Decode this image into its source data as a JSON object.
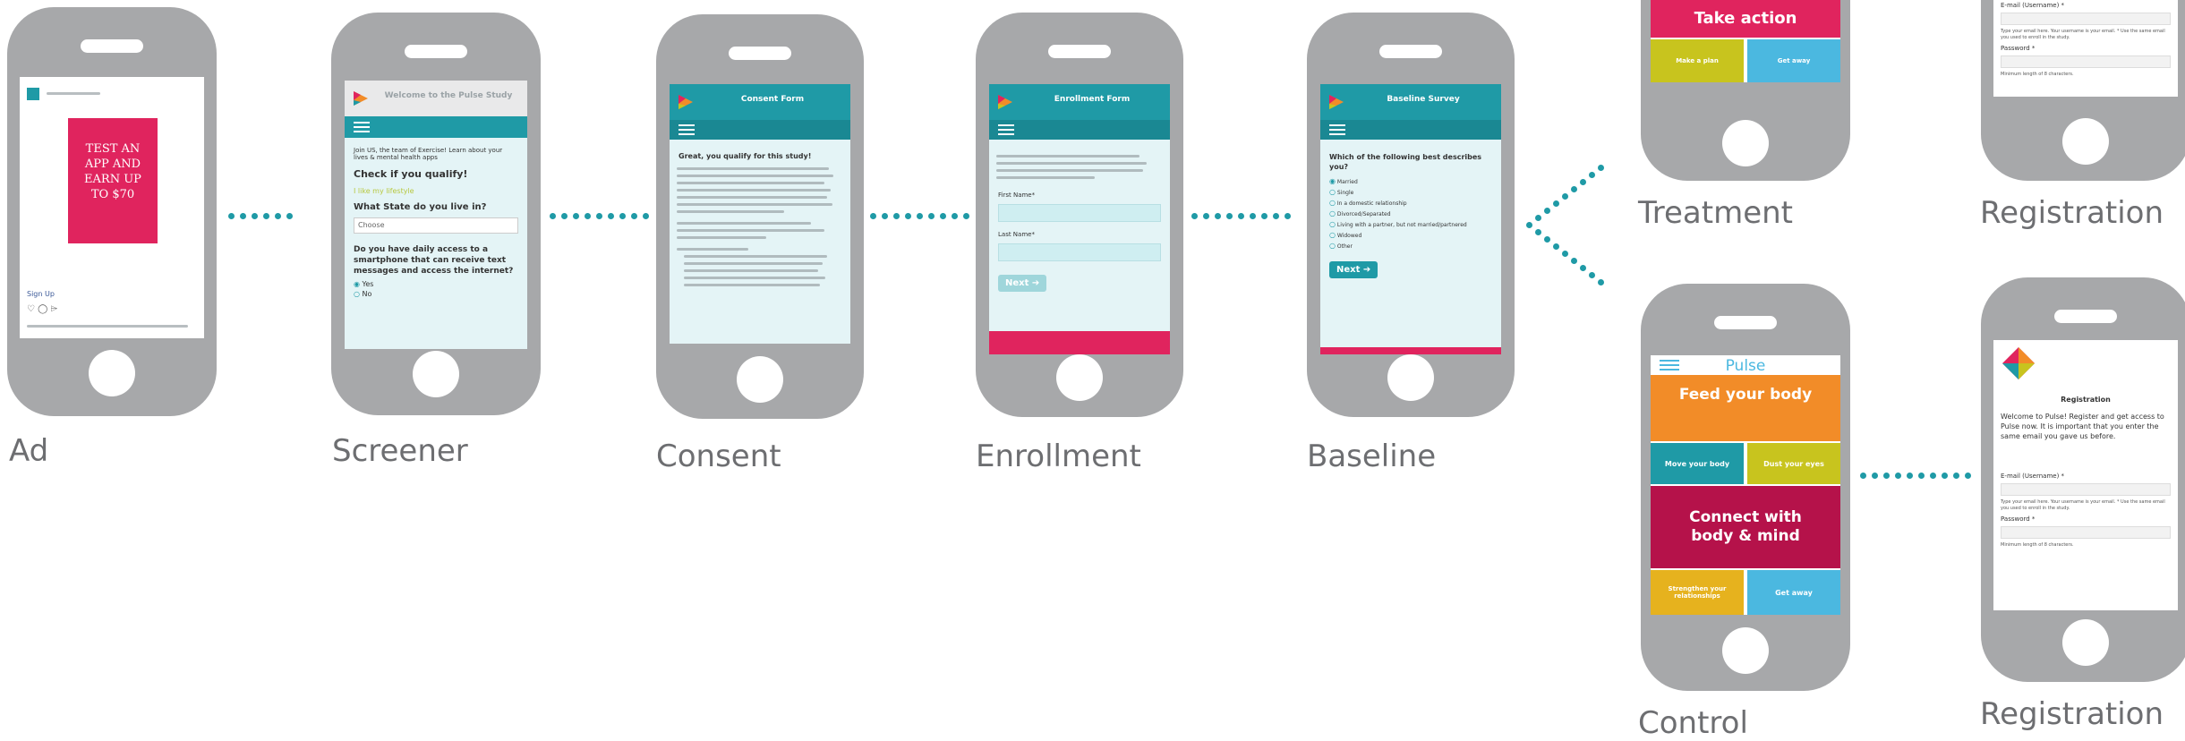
{
  "captions": {
    "ad": "Ad",
    "screener": "Screener",
    "consent": "Consent",
    "enrollment": "Enrollment",
    "baseline": "Baseline",
    "treatment": "Treatment",
    "registration_top": "Registration",
    "control": "Control",
    "registration_bottom": "Registration"
  },
  "ad": {
    "poster_text": "TEST AN APP AND EARN UP TO $70",
    "link": "Sign Up"
  },
  "screener": {
    "header": "Welcome to the Pulse Study",
    "intro": "Join US, the team of Exercise! Learn about your lives & mental health apps",
    "question1": "Check if you qualify!",
    "option": "I like my lifestyle",
    "question2": "What State do you live in?",
    "select_value": "Choose",
    "question3": "Do you have daily access to a smartphone that can receive text messages and access the internet?",
    "yes": "Yes",
    "no": "No"
  },
  "consent": {
    "header": "Consent Form",
    "intro": "Great, you qualify for this study!"
  },
  "enrollment": {
    "header": "Enrollment Form",
    "first_name": "First Name*",
    "last_name": "Last Name*",
    "next": "Next"
  },
  "baseline": {
    "header": "Baseline Survey",
    "question": "Which of the following best describes you?",
    "options": [
      "Married",
      "Single",
      "In a domestic relationship",
      "Divorced/Separated",
      "Living with a partner, but not married/partnered",
      "Widowed",
      "Other"
    ],
    "next": "Next"
  },
  "treatment": {
    "tile_main": "Take action",
    "tile_left": "Make a plan",
    "tile_right": "Get away"
  },
  "registration_top": {
    "email_label": "E-mail (Username) *",
    "email_help": "Type your email here. Your username is your email. * Use the same email you used to enroll in the study.",
    "password_label": "Password *",
    "password_help": "Minimum length of 8 characters."
  },
  "control": {
    "app_name": "Pulse",
    "tile1": "Feed your body",
    "tile2a": "Move your body",
    "tile2b": "Dust your eyes",
    "tile3": "Connect with body & mind",
    "tile4a": "Strengthen your relationships",
    "tile4b": "Get away"
  },
  "registration_bottom": {
    "title": "Registration",
    "welcome": "Welcome to Pulse! Register and get access to Pulse now. It is important that you enter the same email you gave us before.",
    "email_label": "E-mail (Username) *",
    "email_help": "Type your email here. Your username is your email. * Use the same email you used to enroll in the study.",
    "password_label": "Password *",
    "password_help": "Minimum length of 8 characters."
  },
  "colors": {
    "teal": "#1f9aa6",
    "phone_gray": "#a7a8aa",
    "pink": "#e0245e",
    "orange": "#f28c28",
    "yellow": "#c8c41e",
    "crimson": "#b5124a",
    "sky": "#4bb8e0"
  }
}
